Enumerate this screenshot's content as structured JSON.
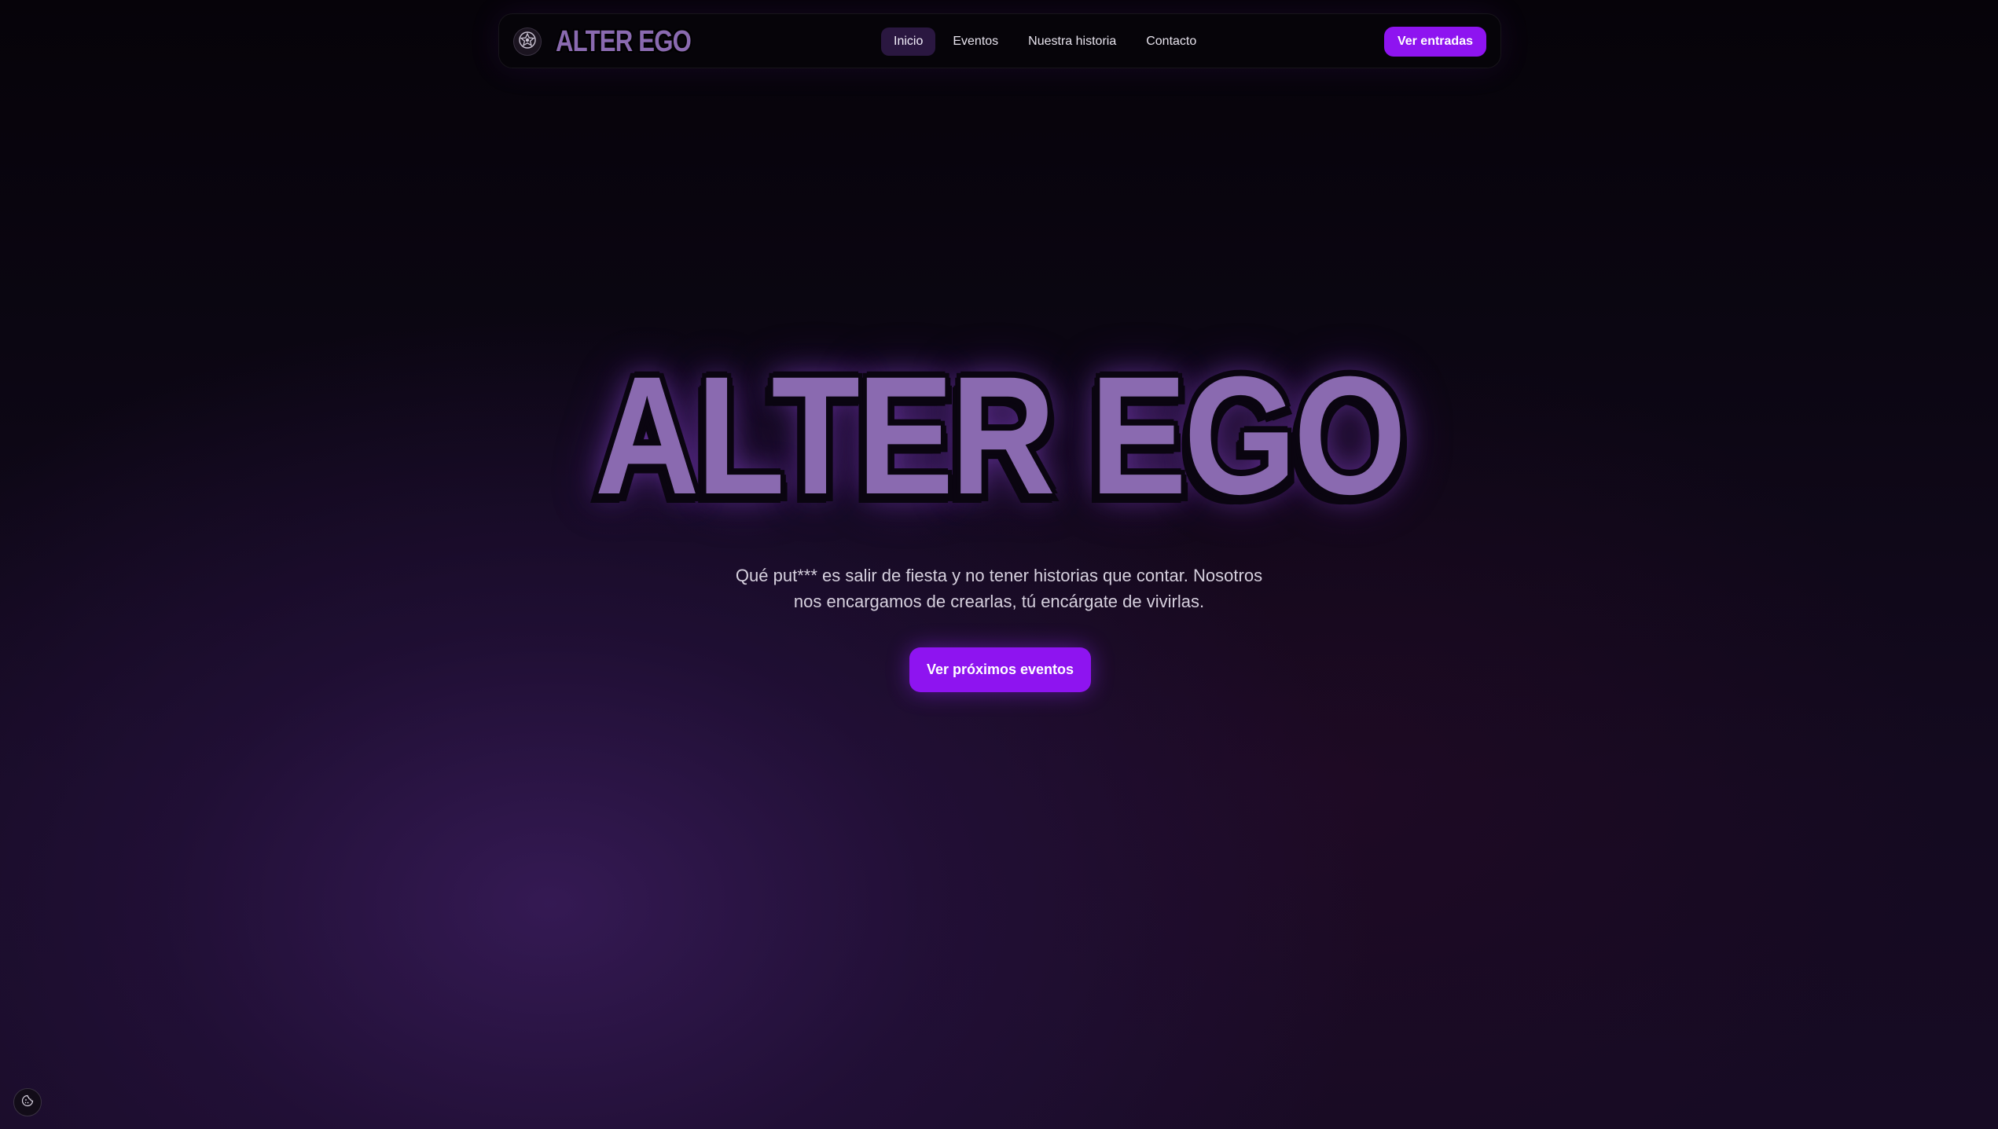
{
  "brand": {
    "logo_icon": "star-emblem-icon",
    "name": "ALTER EGO"
  },
  "nav": {
    "items": [
      {
        "label": "Inicio",
        "active": true
      },
      {
        "label": "Eventos",
        "active": false
      },
      {
        "label": "Nuestra historia",
        "active": false
      },
      {
        "label": "Contacto",
        "active": false
      }
    ],
    "cta_label": "Ver entradas"
  },
  "hero": {
    "title": "ALTER EGO",
    "subtitle": "Qué put*** es salir de fiesta y no tener historias que contar. Nosotros nos encargamos de crearlas, tú encárgate de vivirlas.",
    "cta_label": "Ver próximos eventos"
  },
  "cookie": {
    "icon": "cookie-icon"
  },
  "colors": {
    "accent": "#8e14f0",
    "title_fill": "#8a6ab0",
    "nav_active_bg": "#2a1740",
    "background": "#050308"
  }
}
